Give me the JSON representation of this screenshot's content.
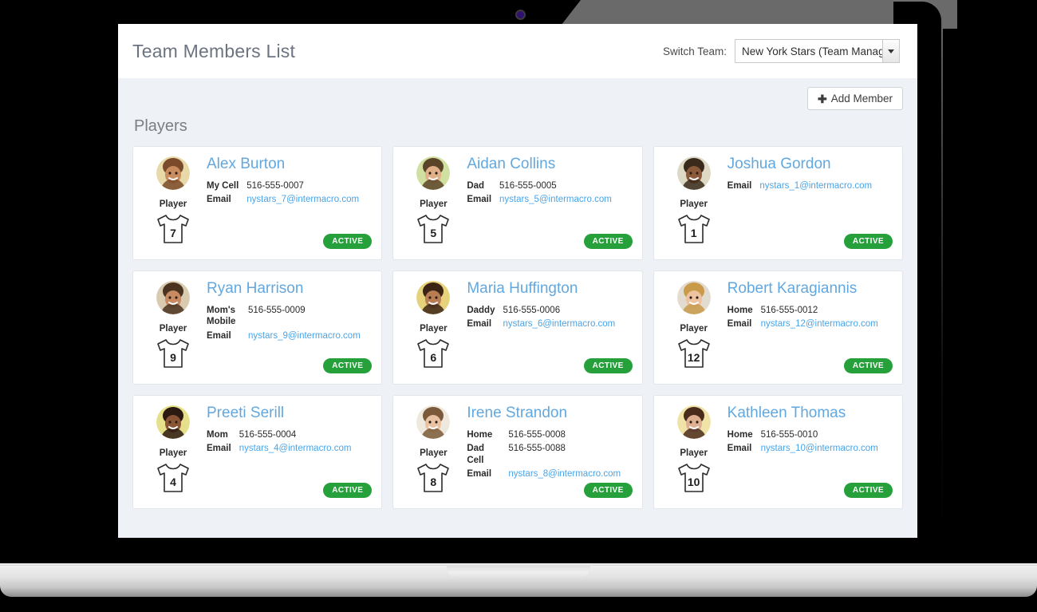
{
  "header": {
    "title": "Team Members List",
    "switch_team_label": "Switch Team:",
    "selected_team": "New York Stars (Team Manage",
    "caret_icon": "chevron-down-icon"
  },
  "toolbar": {
    "add_member_label": "Add Member",
    "plus_icon": "plus-icon"
  },
  "section": {
    "title": "Players"
  },
  "colors": {
    "accent_link": "#49a4e8",
    "name_blue": "#62a8e0",
    "status_green": "#26a03a",
    "page_bg": "#eef1f5",
    "card_bg": "#ffffff"
  },
  "members": [
    {
      "name": "Alex Burton",
      "role": "Player",
      "number": "7",
      "status": "ACTIVE",
      "avatar_skin": "#b07a४f",
      "contacts": [
        {
          "label": "My Cell",
          "value": "516-555-0007",
          "is_link": false
        },
        {
          "label": "Email",
          "value": "nystars_7@intermacro.com",
          "is_link": true
        }
      ]
    },
    {
      "name": "Aidan Collins",
      "role": "Player",
      "number": "5",
      "status": "ACTIVE",
      "contacts": [
        {
          "label": "Dad",
          "value": "516-555-0005",
          "is_link": false
        },
        {
          "label": "Email",
          "value": "nystars_5@intermacro.com",
          "is_link": true
        }
      ]
    },
    {
      "name": "Joshua Gordon",
      "role": "Player",
      "number": "1",
      "status": "ACTIVE",
      "contacts": [
        {
          "label": "Email",
          "value": "nystars_1@intermacro.com",
          "is_link": true
        }
      ]
    },
    {
      "name": "Ryan Harrison",
      "role": "Player",
      "number": "9",
      "status": "ACTIVE",
      "contacts": [
        {
          "label": "Mom's Mobile",
          "value": "516-555-0009",
          "is_link": false
        },
        {
          "label": "Email",
          "value": "nystars_9@intermacro.com",
          "is_link": true
        }
      ]
    },
    {
      "name": "Maria Huffington",
      "role": "Player",
      "number": "6",
      "status": "ACTIVE",
      "contacts": [
        {
          "label": "Daddy",
          "value": "516-555-0006",
          "is_link": false
        },
        {
          "label": "Email",
          "value": "nystars_6@intermacro.com",
          "is_link": true
        }
      ]
    },
    {
      "name": "Robert Karagiannis",
      "role": "Player",
      "number": "12",
      "status": "ACTIVE",
      "contacts": [
        {
          "label": "Home",
          "value": "516-555-0012",
          "is_link": false
        },
        {
          "label": "Email",
          "value": "nystars_12@intermacro.com",
          "is_link": true
        }
      ]
    },
    {
      "name": "Preeti Serill",
      "role": "Player",
      "number": "4",
      "status": "ACTIVE",
      "contacts": [
        {
          "label": "Mom",
          "value": "516-555-0004",
          "is_link": false
        },
        {
          "label": "Email",
          "value": "nystars_4@intermacro.com",
          "is_link": true
        }
      ]
    },
    {
      "name": "Irene Strandon",
      "role": "Player",
      "number": "8",
      "status": "ACTIVE",
      "contacts": [
        {
          "label": "Home",
          "value": "516-555-0008",
          "is_link": false
        },
        {
          "label": "Dad Cell",
          "value": "516-555-0088",
          "is_link": false
        },
        {
          "label": "Email",
          "value": "nystars_8@intermacro.com",
          "is_link": true
        }
      ]
    },
    {
      "name": "Kathleen Thomas",
      "role": "Player",
      "number": "10",
      "status": "ACTIVE",
      "contacts": [
        {
          "label": "Home",
          "value": "516-555-0010",
          "is_link": false
        },
        {
          "label": "Email",
          "value": "nystars_10@intermacro.com",
          "is_link": true
        }
      ]
    }
  ]
}
